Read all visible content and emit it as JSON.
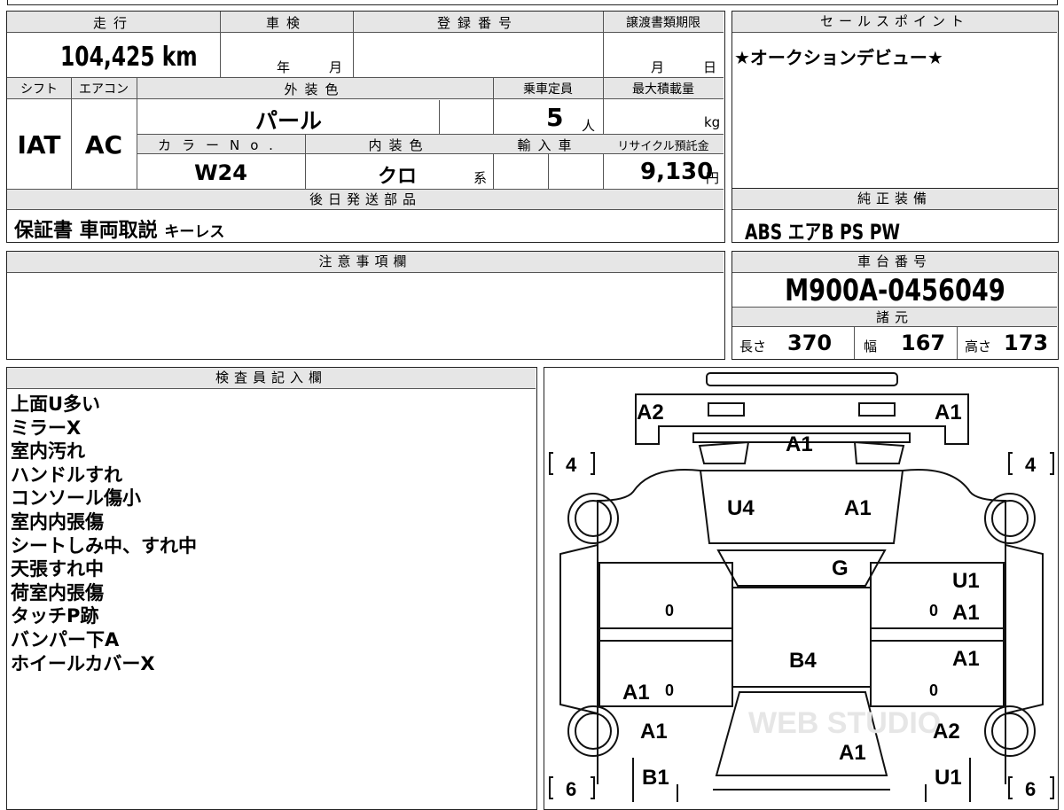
{
  "main": {
    "mileage_label": "走行",
    "mileage_value": "104,425",
    "mileage_unit": "km",
    "shaken_label": "車検",
    "year_label": "年",
    "month_label": "月",
    "reg_label": "登録番号",
    "transfer_label": "譲渡書類期限",
    "transfer_month": "月",
    "transfer_day": "日",
    "shift_label": "シフト",
    "aircon_label": "エアコン",
    "exterior_label": "外装色",
    "capacity_label": "乗車定員",
    "maxload_label": "最大積載量",
    "shift_value": "IAT",
    "aircon_value": "AC",
    "exterior_value": "パール",
    "capacity_value": "5",
    "capacity_unit": "人",
    "maxload_unit": "kg",
    "color_no_label": "カラーNo.",
    "interior_label": "内装色",
    "import_label": "輸入車",
    "recycle_label": "リサイクル預託金",
    "color_no_value": "W24",
    "interior_value": "クロ",
    "interior_suffix": "系",
    "recycle_value": "9,130",
    "recycle_unit": "円",
    "later_parts_label": "後日発送部品",
    "later_parts_value": "保証書 車両取説",
    "later_parts_extra": "キーレス"
  },
  "sales": {
    "label": "セールスポイント",
    "text": "★オークションデビュー★"
  },
  "equipment": {
    "label": "純正装備",
    "text": "ABS エアB PS PW"
  },
  "caution": {
    "label": "注意事項欄"
  },
  "chassis": {
    "label": "車台番号",
    "value": "M900A-0456049",
    "spec_label": "諸元",
    "length_label": "長さ",
    "length_value": "370",
    "width_label": "幅",
    "width_value": "167",
    "height_label": "高さ",
    "height_value": "173"
  },
  "inspector": {
    "label": "検査員記入欄",
    "notes": [
      "上面U多い",
      "ミラーX",
      "室内汚れ",
      "ハンドルすれ",
      "コンソール傷小",
      "室内内張傷",
      "シートしみ中、すれ中",
      "天張すれ中",
      "荷室内張傷",
      "タッチP跡",
      "バンパー下A",
      "ホイールカバーX"
    ]
  },
  "diagram": {
    "tire_fl": "4",
    "tire_fr": "4",
    "tire_rl": "6",
    "tire_rr": "6",
    "front_bumper_left": "A2",
    "front_bumper_right": "A1",
    "grille": "A1",
    "hood_left": "U4",
    "hood_right": "A1",
    "windshield": "G",
    "right_front_door_1": "U1",
    "right_front_door_2": "A1",
    "right_rear_door": "A1",
    "roof": "B4",
    "left_rear_door": "A1",
    "left_quarter": "A1",
    "left_rear_bumper": "B1",
    "right_quarter": "A2",
    "right_rear_bumper": "U1",
    "rear_hatch": "A1",
    "zero_marks": [
      "0",
      "0",
      "0",
      "0"
    ],
    "watermark": "WEB STUDIO"
  }
}
